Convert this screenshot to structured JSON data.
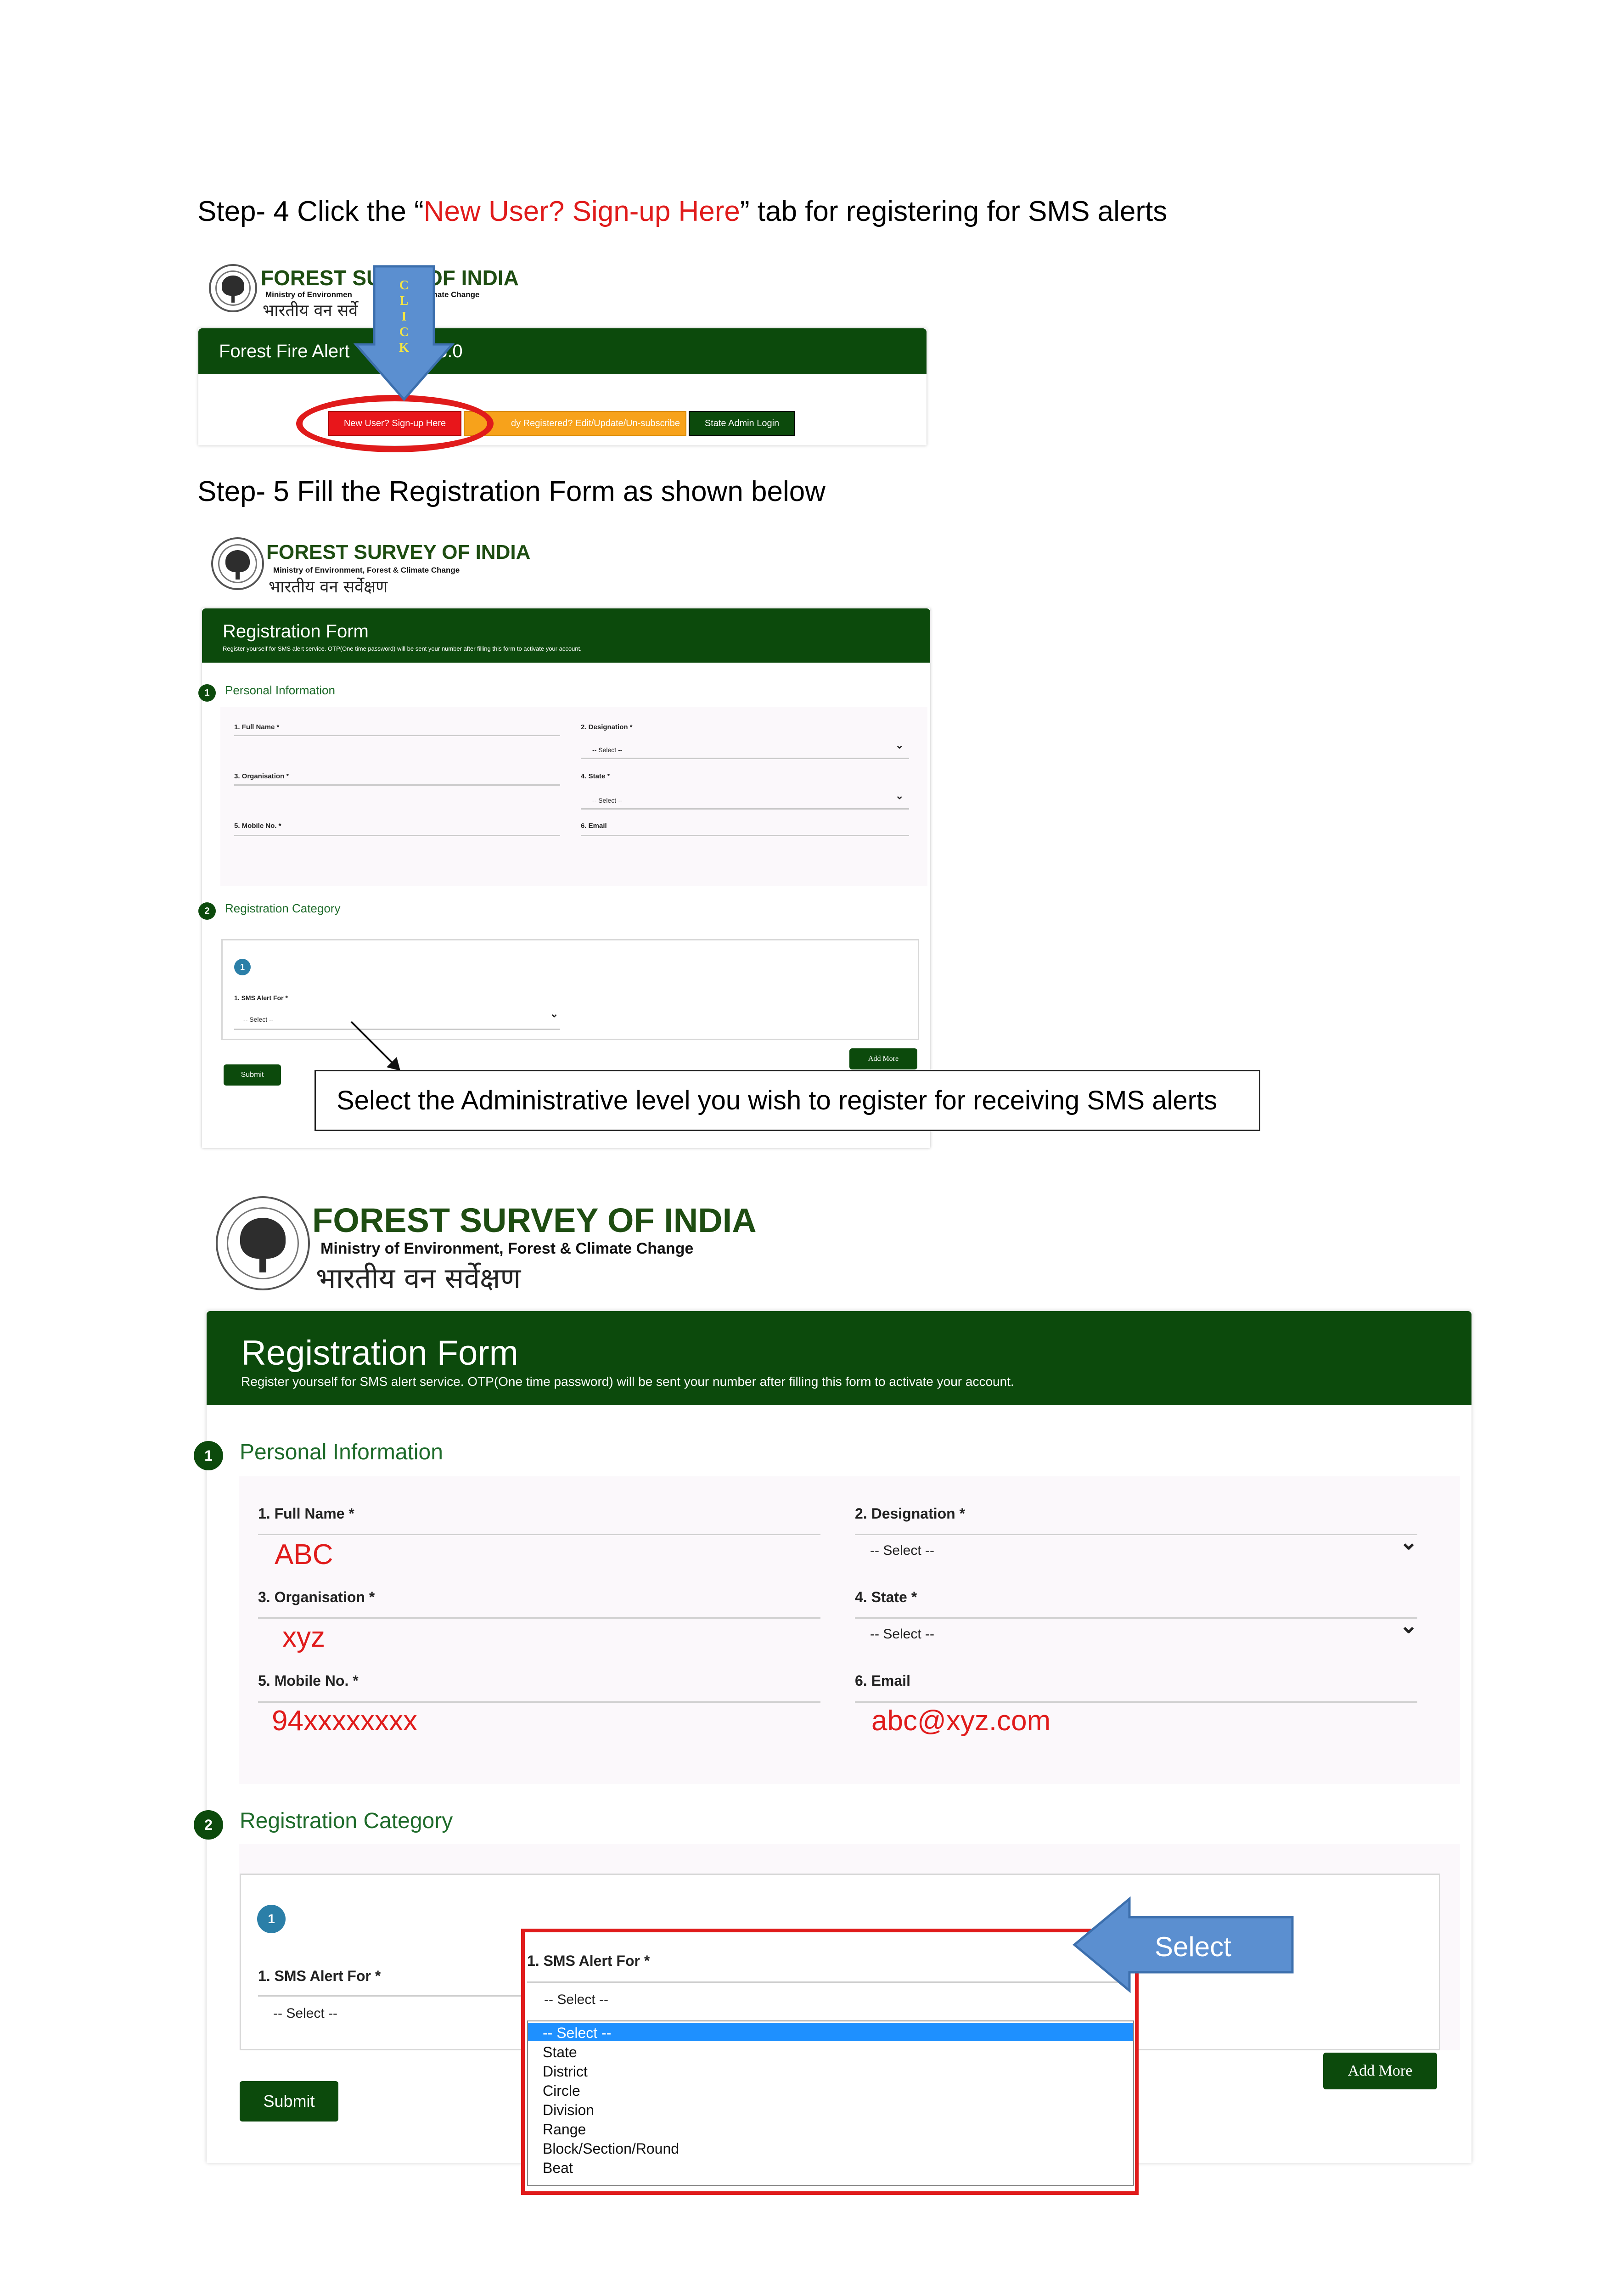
{
  "step4": {
    "prefix": "Step- 4 Click the “",
    "highlight": "New User? Sign-up Here",
    "suffix": "” tab for registering for SMS alerts"
  },
  "step5": {
    "text": "Step- 5 Fill the Registration Form as shown below"
  },
  "logo": {
    "title": "FOREST SURVEY OF INDIA",
    "title_left_part": "FOREST SU",
    "title_right_part": "OF INDIA",
    "subtitle": "Ministry of Environment, Forest & Climate Change",
    "subtitle_left_part": "Ministry of Environmen",
    "subtitle_right_part": "Climate Change",
    "hindi": "भारतीय वन सर्वेक्षण",
    "hindi_part": "भारतीय वन सर्वे"
  },
  "step4_shot": {
    "bar_left": "Forest Fire Alert",
    "bar_right": "3.0",
    "arrow_letters": [
      "C",
      "L",
      "I",
      "C",
      "K"
    ],
    "buttons": {
      "signup": "New User? Sign-up Here",
      "registered": "dy Registered? Edit/Update/Un-subscribe",
      "admin": "State Admin Login"
    }
  },
  "form": {
    "title": "Registration Form",
    "subtitle": "Register yourself for SMS alert service. OTP(One time password) will be sent your number after filling this form to activate your account.",
    "section1_num": "1",
    "section1": "Personal Information",
    "fields": {
      "full_name": "1. Full Name *",
      "designation": "2. Designation *",
      "organisation": "3. Organisation *",
      "state": "4. State *",
      "mobile": "5. Mobile No. *",
      "email": "6. Email"
    },
    "values": {
      "full_name": "ABC",
      "organisation": "xyz",
      "mobile": "94xxxxxxxx",
      "email": "abc@xyz.com"
    },
    "select_placeholder": "-- Select --",
    "chevron": "⌄",
    "section2_num": "2",
    "section2": "Registration Category",
    "category_num": "1",
    "sms_alert_for": "1. SMS Alert For *",
    "add_more": "Add More",
    "submit": "Submit"
  },
  "callout": {
    "text": "Select the Administrative level you wish to register for receiving SMS alerts"
  },
  "select_arrow": {
    "text": "Select"
  },
  "dropdown": {
    "label": "1. SMS Alert For *",
    "current": "-- Select --",
    "options": [
      "-- Select --",
      "State",
      "District",
      "Circle",
      "Division",
      "Range",
      "Block/Section/Round",
      "Beat"
    ]
  },
  "colors": {
    "header_green": "#0c4a0c",
    "highlight_red": "#e01b1b",
    "signup_red": "#e8161b",
    "orange": "#f7a21b",
    "arrow_blue": "#5b8fd0",
    "select_blue": "#1e90ff"
  }
}
